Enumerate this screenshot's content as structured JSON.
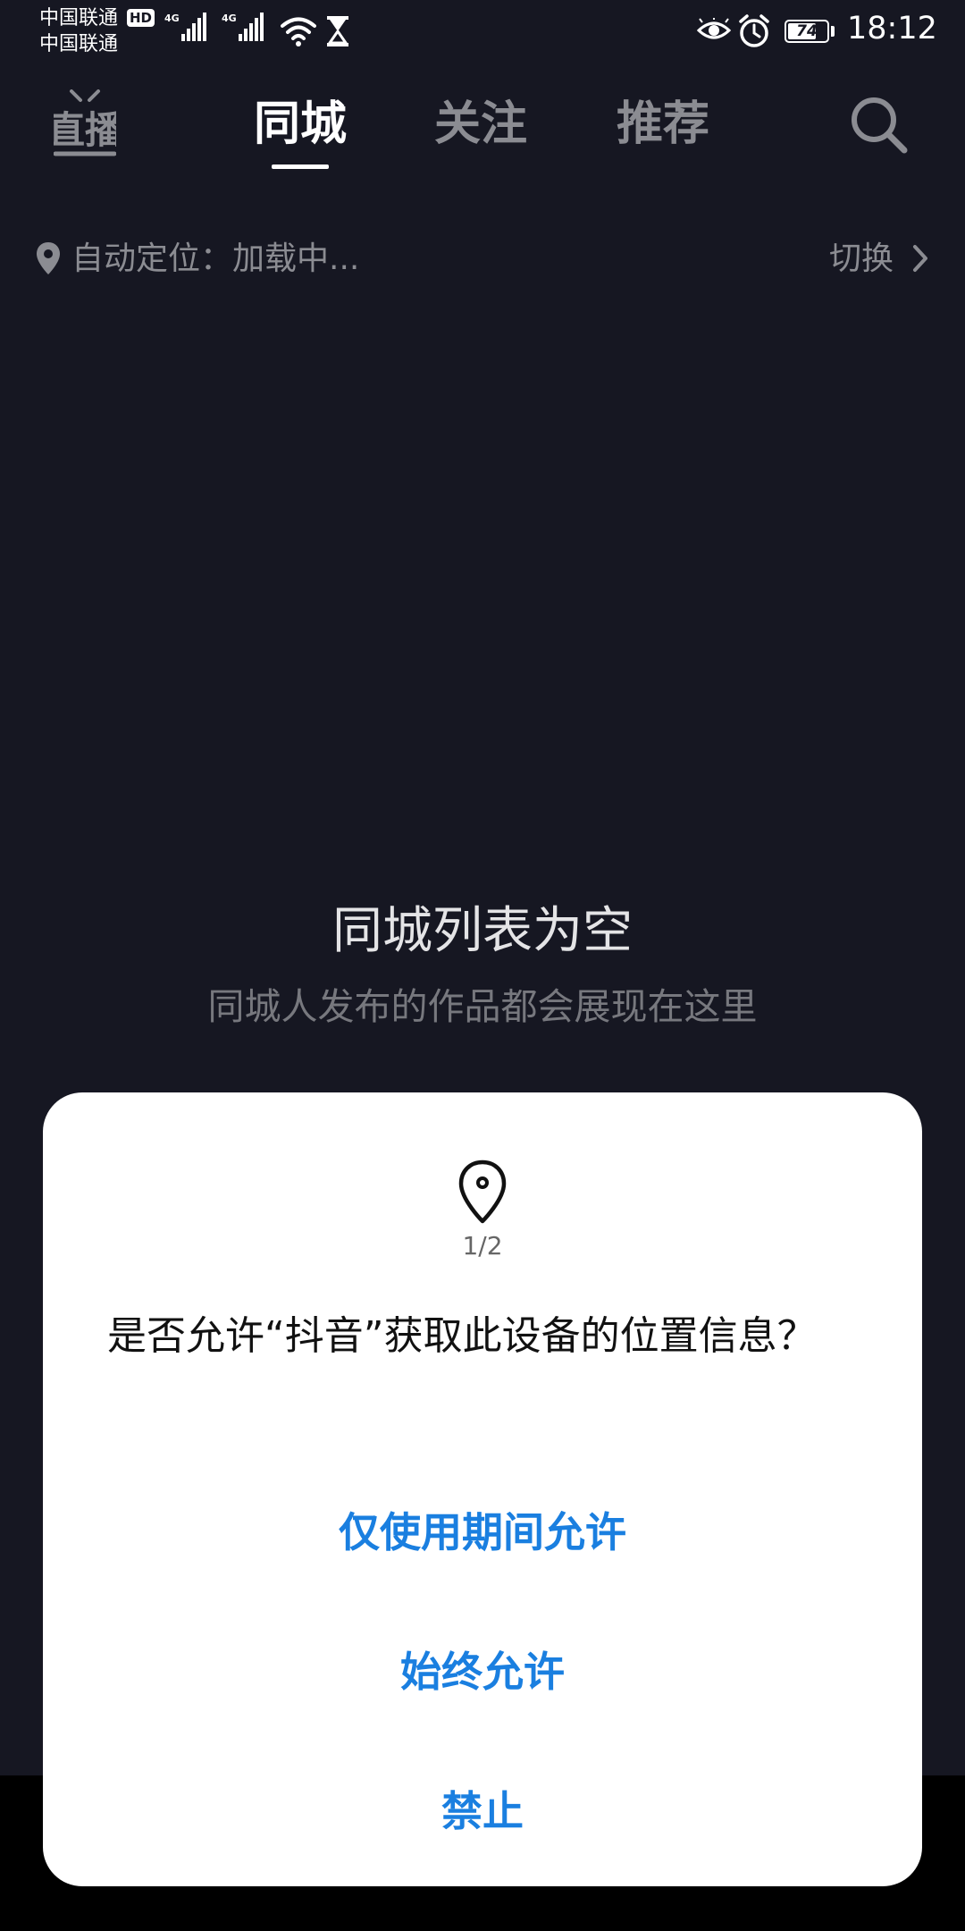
{
  "status_bar": {
    "carrier1": "中国联通",
    "carrier2": "中国联通",
    "hd_badge": "HD",
    "net1": "4G",
    "net2": "4G",
    "battery": "74",
    "battery_level": 0.74,
    "time": "18:12"
  },
  "nav": {
    "live_label": "直播",
    "tabs": [
      {
        "label": "同城",
        "active": true
      },
      {
        "label": "关注",
        "active": false
      },
      {
        "label": "推荐",
        "active": false
      }
    ]
  },
  "location_bar": {
    "text": "自动定位：加载中...",
    "switch_label": "切换"
  },
  "empty_state": {
    "title": "同城列表为空",
    "subtitle": "同城人发布的作品都会展现在这里"
  },
  "dialog": {
    "counter": "1/2",
    "message": "是否允许“抖音”获取此设备的位置信息？",
    "buttons": {
      "while_using": "仅使用期间允许",
      "always": "始终允许",
      "deny": "禁止"
    }
  },
  "colors": {
    "background": "#161722",
    "accent_blue": "#1a7fe0",
    "muted_text": "#8b8c92"
  },
  "icons": [
    "live-icon",
    "search-icon",
    "location-pin-icon",
    "chevron-right-icon",
    "wifi-icon",
    "hourglass-icon",
    "eye-icon",
    "alarm-icon",
    "battery-icon"
  ]
}
